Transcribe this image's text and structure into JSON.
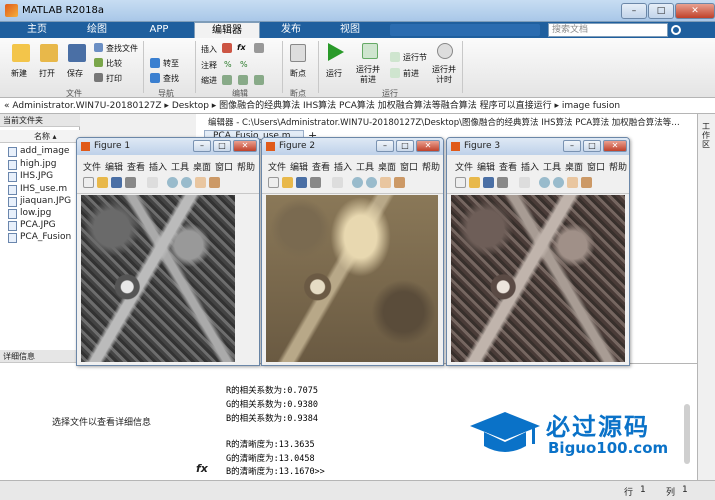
{
  "window": {
    "title": "MATLAB R2018a",
    "min": "–",
    "max": "□",
    "close": "✕"
  },
  "tabs": [
    "主页",
    "绘图",
    "APP",
    "编辑器",
    "发布",
    "视图"
  ],
  "search_placeholder": "搜索文档",
  "ribbon": {
    "file": {
      "new": "新建",
      "open": "打开",
      "save": "保存",
      "find_file": "查找文件",
      "compare": "比较",
      "print": "打印",
      "group": "文件"
    },
    "nav": {
      "goto": "转至",
      "find": "查找",
      "group": "导航"
    },
    "edit": {
      "insert": "插入",
      "fx": "fx",
      "comment": "注释",
      "pct": "%",
      "indent": "缩进",
      "group": "编辑"
    },
    "breakpoints": {
      "label": "断点",
      "group": "断点"
    },
    "run": {
      "run": "运行",
      "run_advance": "运行并\n前进",
      "run_section": "运行节",
      "advance": "前进",
      "run_time": "运行并\n计时",
      "group": "运行"
    }
  },
  "address": "« Administrator.WIN7U-20180127Z ▸ Desktop ▸ 图像融合的经典算法 IHS算法 PCA算法 加权融合算法等融合算法 程序可以直接运行 ▸ image fusion",
  "current_folder": {
    "header": "当前文件夹",
    "col_name": "名称 ▴",
    "files": [
      "add_image",
      "high.jpg",
      "IHS.JPG",
      "IHS_use.m",
      "jiaquan.JPG",
      "low.jpg",
      "PCA.JPG",
      "PCA_Fusion"
    ]
  },
  "details": {
    "header": "详细信息",
    "message": "选择文件以查看详细信息"
  },
  "editor": {
    "path": "编辑器 - C:\\Users\\Administrator.WIN7U-20180127Z\\Desktop\\图像融合的经典算法 IHS算法 PCA算法 加权融合算法等…",
    "tab": "PCA_Fusio_use.m",
    "tab_close": "×",
    "add": "+"
  },
  "command": {
    "lines": [
      "R的相关系数为:0.7075",
      "G的相关系数为:0.9380",
      "B的相关系数为:0.9384",
      "",
      "R的清晰度为:13.3635",
      "G的清晰度为:13.0458",
      "B的清晰度为:13.1670>>"
    ],
    "fx": "fx"
  },
  "figures": [
    {
      "title": "Figure 1",
      "menu": [
        "文件",
        "编辑",
        "查看",
        "插入",
        "工具",
        "桌面",
        "窗口",
        "帮助"
      ]
    },
    {
      "title": "Figure 2",
      "menu": [
        "文件",
        "编辑",
        "查看",
        "插入",
        "工具",
        "桌面",
        "窗口",
        "帮助"
      ]
    },
    {
      "title": "Figure 3",
      "menu": [
        "文件",
        "编辑",
        "查看",
        "插入",
        "工具",
        "桌面",
        "窗口",
        "帮助"
      ]
    }
  ],
  "right_strip": "工作区",
  "status": {
    "row_label": "行",
    "row": "1",
    "col_label": "列",
    "col": "1"
  },
  "watermark": {
    "line1": "必过源码",
    "line2": "Biguo100.com"
  },
  "colors": {
    "accent": "#1f5f9e",
    "watermark": "#0a72c8"
  }
}
